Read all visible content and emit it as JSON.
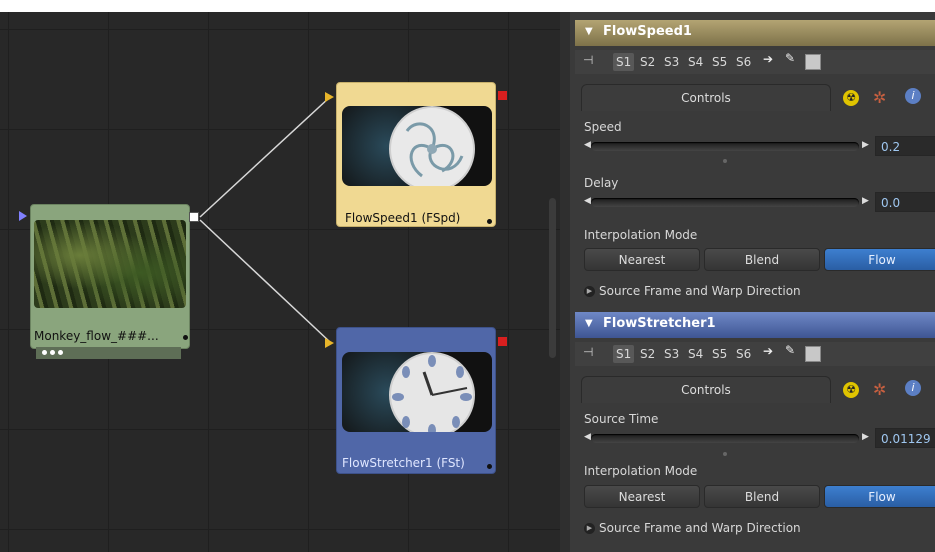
{
  "flow": {
    "nodes": [
      {
        "id": "loader",
        "label": "Monkey_flow_###...",
        "color": "#8aa57d"
      },
      {
        "id": "flowspeed",
        "label": "FlowSpeed1  (FSpd)",
        "color": "#f0d992"
      },
      {
        "id": "flowstretcher",
        "label": "FlowStretcher1  (FSt)",
        "color": "#5067a8"
      }
    ]
  },
  "inspector": {
    "sections": [
      {
        "title": "FlowSpeed1",
        "header_color": "#8a7f5a",
        "slots": [
          "S1",
          "S2",
          "S3",
          "S4",
          "S5",
          "S6"
        ],
        "active_slot": "S1",
        "tab_label": "Controls",
        "controls": [
          {
            "label": "Speed",
            "value": "0.2"
          },
          {
            "label": "Delay",
            "value": "0.0"
          }
        ],
        "mode_label": "Interpolation Mode",
        "mode_options": [
          "Nearest",
          "Blend",
          "Flow"
        ],
        "mode_selected": "Flow",
        "disclosure_label": "Source Frame and Warp Direction"
      },
      {
        "title": "FlowStretcher1",
        "header_color": "#4d68a8",
        "slots": [
          "S1",
          "S2",
          "S3",
          "S4",
          "S5",
          "S6"
        ],
        "active_slot": "S1",
        "tab_label": "Controls",
        "controls": [
          {
            "label": "Source Time",
            "value": "0.01129"
          }
        ],
        "mode_label": "Interpolation Mode",
        "mode_options": [
          "Nearest",
          "Blend",
          "Flow"
        ],
        "mode_selected": "Flow",
        "disclosure_label": "Source Frame and Warp Direction"
      }
    ]
  }
}
